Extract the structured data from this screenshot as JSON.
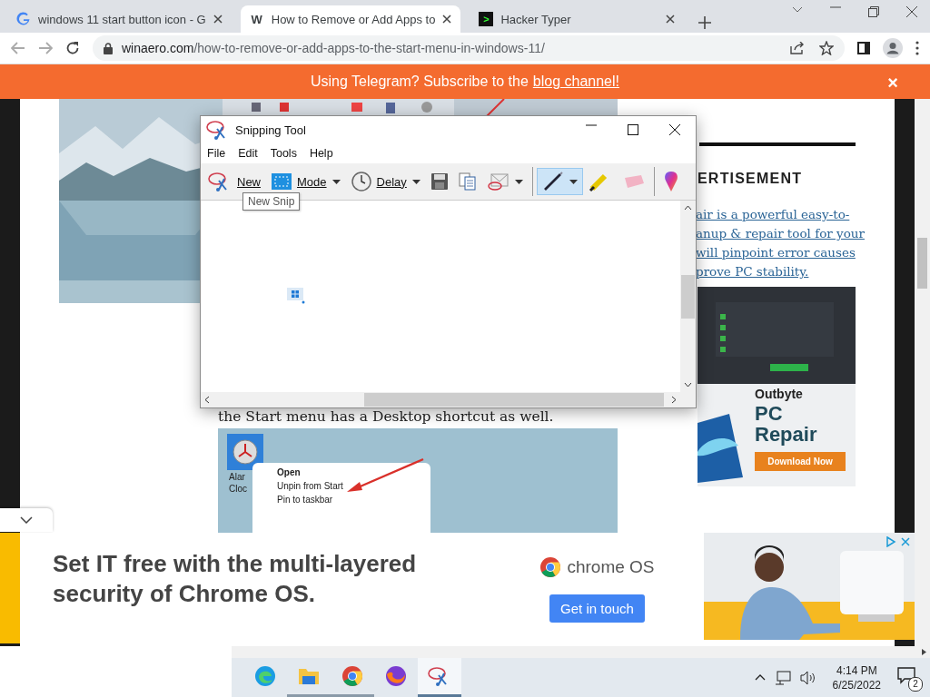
{
  "browser": {
    "tabs": [
      {
        "title": "windows 11 start button icon - G",
        "selected": false
      },
      {
        "title": "How to Remove or Add Apps to",
        "favicon_text": "W",
        "selected": true
      },
      {
        "title": "Hacker Typer",
        "favicon_text": ">",
        "selected": false
      }
    ],
    "address": {
      "host": "winaero.com",
      "path": "/how-to-remove-or-add-apps-to-the-start-menu-in-windows-11/"
    }
  },
  "banner": {
    "text": "Using Telegram? Subscribe to the",
    "link": "blog channel!",
    "close": "×"
  },
  "article": {
    "sentence": "the Start menu has a Desktop shortcut as well.",
    "shortcut_label": [
      "Alar",
      "Cloc"
    ],
    "context_menu": [
      {
        "label": "Open",
        "bold": true
      },
      {
        "label": "Unpin from Start",
        "bold": false
      },
      {
        "label": "Pin to taskbar",
        "bold": false
      }
    ]
  },
  "sidebar": {
    "heading": "ERTISEMENT",
    "link_lines": [
      "air is a powerful easy-to-",
      "anup & repair tool for your",
      "will pinpoint error causes",
      "prove PC stability."
    ],
    "ad": {
      "brand": "Outbyte",
      "product": "PC Repair",
      "button": "Download Now"
    }
  },
  "snipping_tool": {
    "title": "Snipping Tool",
    "menu": [
      "File",
      "Edit",
      "Tools",
      "Help"
    ],
    "tooltip": "New Snip",
    "toolbar": [
      {
        "kind": "button",
        "label": "New",
        "dropdown": false,
        "selected": false
      },
      {
        "kind": "button",
        "label": "Mode",
        "dropdown": true,
        "selected": false
      },
      {
        "kind": "button",
        "label": "Delay",
        "dropdown": true,
        "selected": false
      },
      {
        "kind": "button",
        "dropdown": false,
        "selected": false
      },
      {
        "kind": "button",
        "dropdown": false,
        "selected": false
      },
      {
        "kind": "button",
        "dropdown": true,
        "selected": false
      },
      {
        "kind": "separator"
      },
      {
        "kind": "button",
        "dropdown": true,
        "selected": true
      },
      {
        "kind": "button",
        "dropdown": false,
        "selected": false
      },
      {
        "kind": "button",
        "dropdown": false,
        "selected": false
      },
      {
        "kind": "separator"
      },
      {
        "kind": "button",
        "dropdown": false,
        "selected": false
      }
    ]
  },
  "bottom_ad": {
    "headline": "Set IT free with the multi-layered security of Chrome OS.",
    "logo_text": "chrome OS",
    "button": "Get in touch"
  },
  "taskbar": {
    "apps": [
      {
        "running": false,
        "selected": false
      },
      {
        "running": true,
        "selected": false
      },
      {
        "running": true,
        "selected": false
      },
      {
        "running": false,
        "selected": false
      },
      {
        "running": true,
        "selected": true
      }
    ],
    "time": "4:14 PM",
    "date": "6/25/2022",
    "notifications": "2"
  }
}
